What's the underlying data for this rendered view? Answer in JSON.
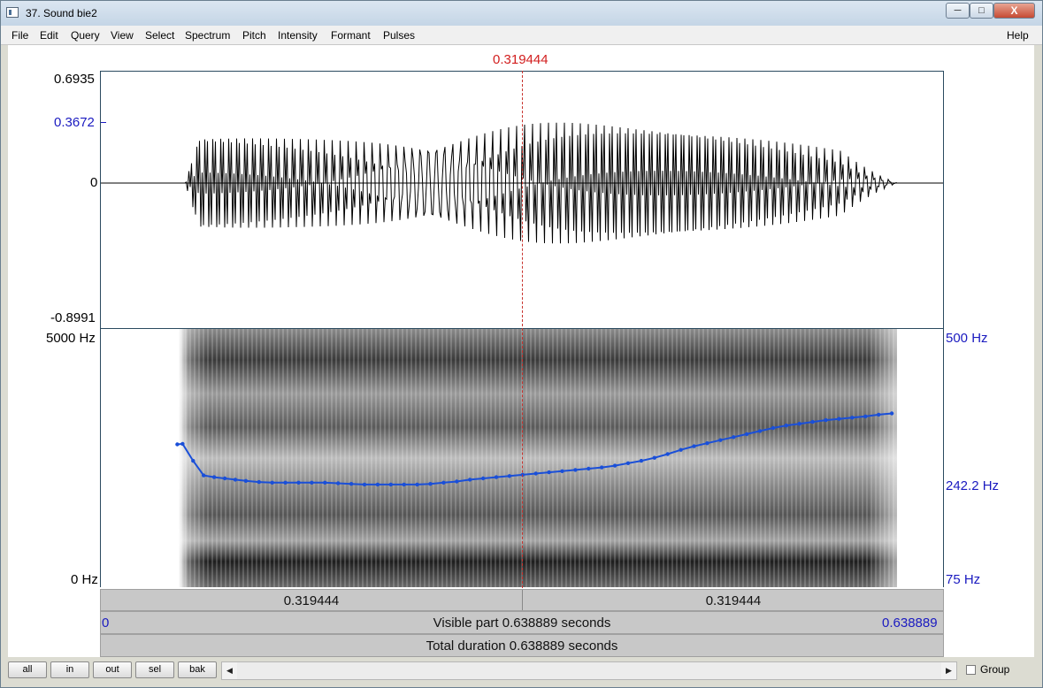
{
  "window": {
    "title": "37. Sound bie2",
    "minimize_glyph": "─",
    "maximize_glyph": "□",
    "close_glyph": "X"
  },
  "menu": [
    "File",
    "Edit",
    "Query",
    "View",
    "Select",
    "Spectrum",
    "Pitch",
    "Intensity",
    "Formant",
    "Pulses"
  ],
  "help": "Help",
  "cursor_time": "0.319444",
  "waveform": {
    "max_label": "0.6935",
    "mark_label": "0.3672",
    "zero_label": "0",
    "min_label": "-0.8991",
    "max_value": 0.6935,
    "mark_value": 0.3672,
    "min_value": -0.8991
  },
  "spectrogram": {
    "freq_top_label": "5000 Hz",
    "freq_bottom_label": "0 Hz",
    "pitch_top_label": "500 Hz",
    "pitch_mid_label": "242.2 Hz",
    "pitch_bottom_label": "75 Hz"
  },
  "time_bar": {
    "left_half": "0.319444",
    "right_half": "0.319444"
  },
  "visible_bar": {
    "start": "0",
    "label": "Visible part 0.638889 seconds",
    "end": "0.638889"
  },
  "total_bar": {
    "label": "Total duration 0.638889 seconds"
  },
  "buttons": {
    "all": "all",
    "in": "in",
    "out": "out",
    "sel": "sel",
    "bak": "bak"
  },
  "scroll": {
    "left_arrow": "◀",
    "right_arrow": "▶"
  },
  "group_label": "Group",
  "colors": {
    "cursor": "#d21e1e",
    "pitch_line": "#1a4fd8",
    "axis_blue": "#1a1ac0"
  },
  "pitch_track": {
    "duration": 0.638889,
    "pitch_min": 75,
    "pitch_max": 500,
    "points": [
      [
        0.058,
        310
      ],
      [
        0.062,
        311
      ],
      [
        0.07,
        283
      ],
      [
        0.078,
        259
      ],
      [
        0.086,
        256
      ],
      [
        0.094,
        254
      ],
      [
        0.102,
        252
      ],
      [
        0.11,
        250
      ],
      [
        0.12,
        248
      ],
      [
        0.13,
        247
      ],
      [
        0.14,
        247
      ],
      [
        0.15,
        247
      ],
      [
        0.16,
        247
      ],
      [
        0.17,
        247
      ],
      [
        0.18,
        246
      ],
      [
        0.19,
        245
      ],
      [
        0.2,
        244
      ],
      [
        0.21,
        244
      ],
      [
        0.22,
        244
      ],
      [
        0.23,
        244
      ],
      [
        0.24,
        244
      ],
      [
        0.25,
        245
      ],
      [
        0.26,
        247
      ],
      [
        0.27,
        249
      ],
      [
        0.28,
        252
      ],
      [
        0.29,
        254
      ],
      [
        0.3,
        256
      ],
      [
        0.31,
        258
      ],
      [
        0.32,
        260
      ],
      [
        0.33,
        262
      ],
      [
        0.34,
        264
      ],
      [
        0.35,
        266
      ],
      [
        0.36,
        268
      ],
      [
        0.37,
        270
      ],
      [
        0.38,
        272
      ],
      [
        0.39,
        275
      ],
      [
        0.4,
        279
      ],
      [
        0.41,
        283
      ],
      [
        0.42,
        288
      ],
      [
        0.43,
        294
      ],
      [
        0.44,
        301
      ],
      [
        0.45,
        307
      ],
      [
        0.46,
        312
      ],
      [
        0.47,
        317
      ],
      [
        0.48,
        322
      ],
      [
        0.49,
        327
      ],
      [
        0.5,
        332
      ],
      [
        0.51,
        337
      ],
      [
        0.52,
        341
      ],
      [
        0.53,
        344
      ],
      [
        0.54,
        347
      ],
      [
        0.55,
        350
      ],
      [
        0.56,
        352
      ],
      [
        0.57,
        354
      ],
      [
        0.58,
        356
      ],
      [
        0.59,
        359
      ],
      [
        0.6,
        361
      ]
    ]
  }
}
